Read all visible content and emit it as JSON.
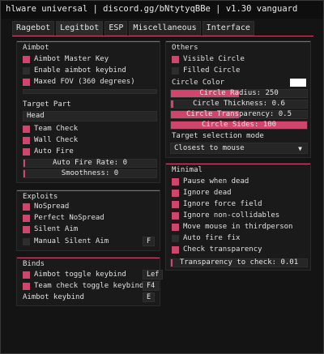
{
  "title": "hlware universal | discord.gg/bNtytyqBBe | v1.30 vanguard",
  "tabs": [
    "Ragebot",
    "Legitbot",
    "ESP",
    "Miscellaneous",
    "Interface"
  ],
  "accent_color": "#d0456b",
  "aimbot": {
    "header": "Aimbot",
    "items": [
      {
        "label": "Aimbot Master Key",
        "checked": true
      },
      {
        "label": "Enable aimbot keybind",
        "checked": false
      },
      {
        "label": "Maxed FOV (360 degrees)",
        "checked": true
      }
    ]
  },
  "target_part": {
    "header": "Target Part",
    "field_value": "Head",
    "items": [
      {
        "label": "Team Check",
        "checked": true
      },
      {
        "label": "Wall Check",
        "checked": true
      },
      {
        "label": "Auto Fire",
        "checked": true
      }
    ],
    "auto_fire_rate": {
      "label": "Auto Fire Rate: 0",
      "value": 0
    },
    "smoothness": {
      "label": "Smoothness: 0",
      "value": 0
    }
  },
  "exploits": {
    "header": "Exploits",
    "items": [
      {
        "label": "NoSpread",
        "checked": true
      },
      {
        "label": "Perfect NoSpread",
        "checked": true
      },
      {
        "label": "Silent Aim",
        "checked": true
      },
      {
        "label": "Manual Silent Aim",
        "checked": false,
        "key": "F"
      }
    ]
  },
  "binds": {
    "header": "Binds",
    "items": [
      {
        "label": "Aimbot toggle keybind",
        "checked": true,
        "key": "Lef"
      },
      {
        "label": "Team check toggle keybind",
        "checked": true,
        "key": "F4"
      },
      {
        "label": "Aimbot keybind",
        "key": "E"
      }
    ]
  },
  "others": {
    "header": "Others",
    "items": [
      {
        "label": "Visible Circle",
        "checked": true
      },
      {
        "label": "Filled Circle",
        "checked": false
      }
    ],
    "circle_color_label": "Circle Color",
    "circle_color": "#ffffff",
    "sliders": [
      {
        "label": "Circle Radius: 250",
        "fraction": 0.5
      },
      {
        "label": "Circle Thickness: 0.6",
        "fraction": 0.02
      },
      {
        "label": "Circle Transparency: 0.5",
        "fraction": 0.5
      },
      {
        "label": "Circle Sides: 100",
        "fraction": 1.0
      }
    ],
    "target_mode_label": "Target selection mode",
    "target_mode_value": "Closest to mouse"
  },
  "minimal": {
    "header": "Minimal",
    "items": [
      {
        "label": "Pause when dead",
        "checked": true
      },
      {
        "label": "Ignore dead",
        "checked": true
      },
      {
        "label": "Ignore force field",
        "checked": true
      },
      {
        "label": "Ignore non-collidables",
        "checked": true
      },
      {
        "label": "Move mouse in thirdperson",
        "checked": true
      },
      {
        "label": "Auto fire fix",
        "checked": false
      },
      {
        "label": "Check transparency",
        "checked": true
      }
    ],
    "transparency": {
      "label": "Transparency to check: 0.01",
      "value": 0.01
    }
  }
}
